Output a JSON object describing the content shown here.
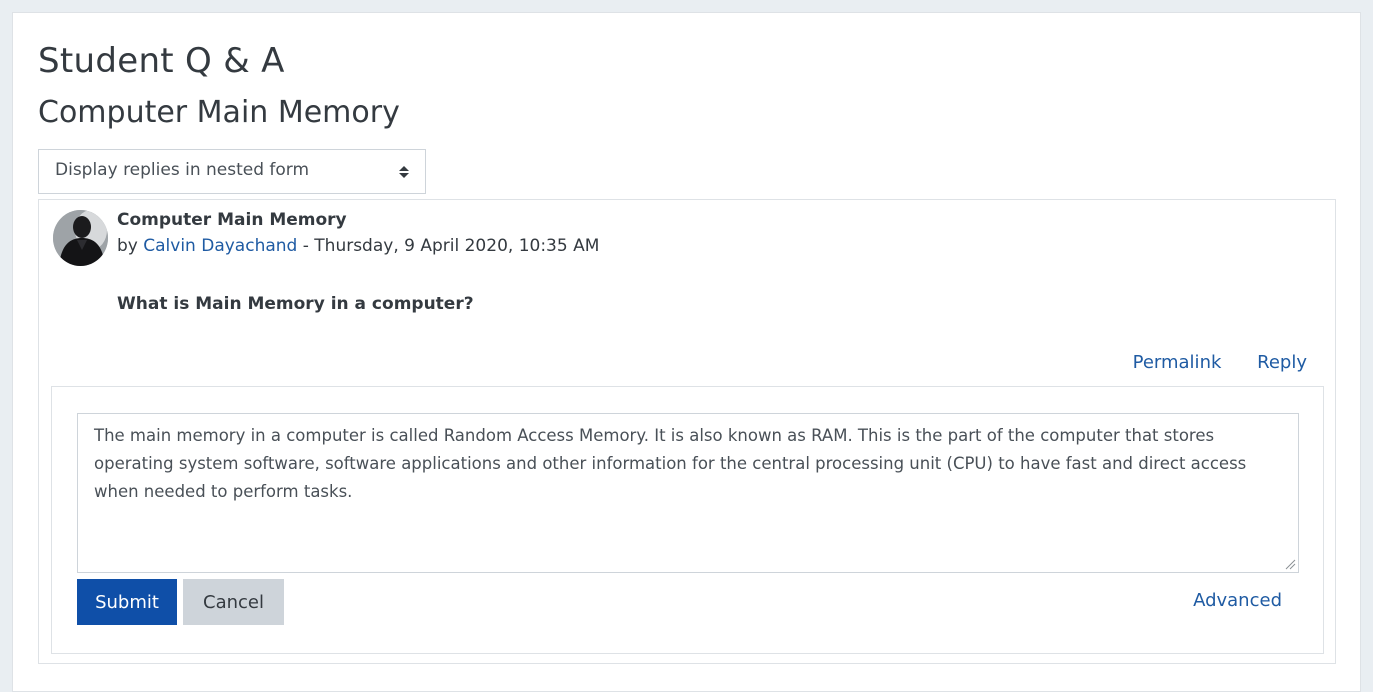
{
  "page": {
    "title": "Student Q & A",
    "subtitle": "Computer Main Memory"
  },
  "display_mode": {
    "selected": "Display replies in nested form"
  },
  "post": {
    "subject": "Computer Main Memory",
    "by_prefix": "by",
    "author": "Calvin Dayachand",
    "date_separator": " - ",
    "date": "Thursday, 9 April 2020, 10:35 AM",
    "body": "What is Main Memory in a computer?",
    "permalink_label": "Permalink",
    "reply_label": "Reply"
  },
  "reply_form": {
    "text": "The main memory in a computer is called Random Access Memory. It is also known as RAM. This is the part of the computer that stores operating system software, software applications and other information for the central processing unit (CPU) to have fast and direct access when needed to perform tasks.",
    "submit_label": "Submit",
    "cancel_label": "Cancel",
    "advanced_label": "Advanced"
  },
  "colors": {
    "link": "#1f5ba3",
    "primary_button": "#0f4fa8",
    "secondary_button": "#ced4da",
    "text": "#343a40",
    "border": "#dee2e6"
  },
  "icons": {
    "select": "up-down-arrows-icon",
    "resize": "resize-grip-icon"
  }
}
